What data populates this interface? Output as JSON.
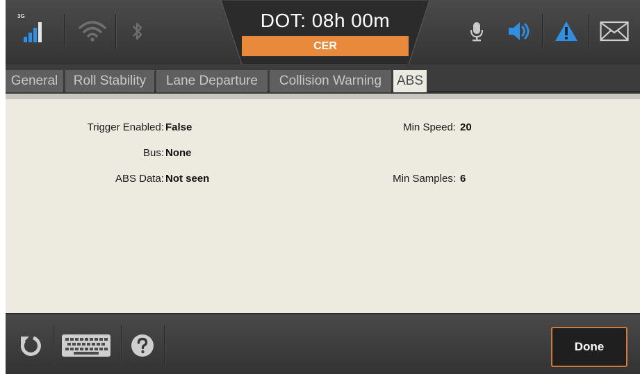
{
  "status_bar": {
    "network_label": "3G",
    "center_title": "DOT: 08h 00m",
    "center_status": "CER",
    "colors": {
      "accent_orange": "#e8893b",
      "icon_blue": "#2f8fe3"
    },
    "icons": [
      "signal-icon",
      "wifi-icon",
      "bluetooth-icon",
      "microphone-icon",
      "speaker-icon",
      "warning-icon",
      "mail-icon"
    ]
  },
  "tabs": [
    {
      "label": "General",
      "active": false
    },
    {
      "label": "Roll Stability",
      "active": false
    },
    {
      "label": "Lane Departure",
      "active": false
    },
    {
      "label": "Collision Warning",
      "active": false
    },
    {
      "label": "ABS",
      "active": true
    }
  ],
  "fields": {
    "trigger_enabled": {
      "label": "Trigger Enabled:",
      "value": "False"
    },
    "bus": {
      "label": "Bus:",
      "value": "None"
    },
    "abs_data": {
      "label": "ABS Data:",
      "value": "Not seen"
    },
    "min_speed": {
      "label": "Min Speed:",
      "value": "20"
    },
    "min_samples": {
      "label": "Min Samples:",
      "value": "6"
    }
  },
  "bottom_bar": {
    "icons": [
      "refresh-icon",
      "keyboard-icon",
      "help-icon"
    ],
    "done_label": "Done"
  }
}
